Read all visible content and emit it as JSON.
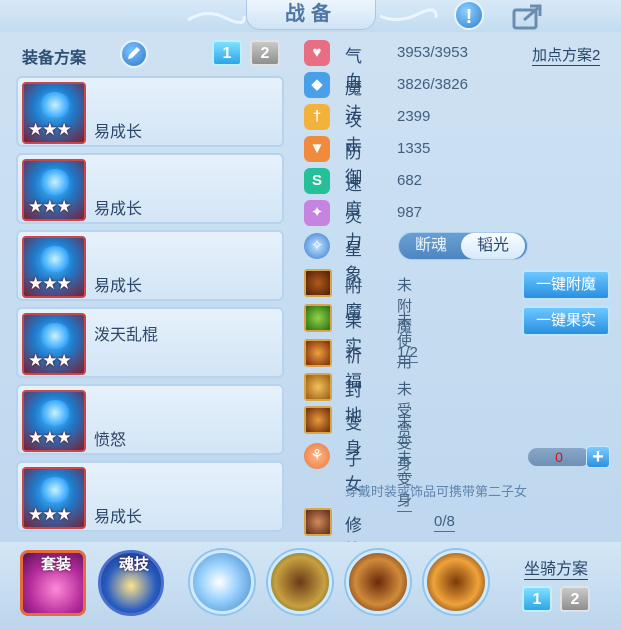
{
  "header": {
    "title": "战备",
    "warn_icon": "exclamation-icon",
    "share_icon": "share-icon"
  },
  "equip_plan": {
    "label": "装备方案",
    "plans": [
      "1",
      "2"
    ],
    "active_plan": "1",
    "items": [
      {
        "name": "易成长",
        "stars": "★★★"
      },
      {
        "name": "易成长",
        "stars": "★★★"
      },
      {
        "name": "易成长",
        "stars": "★★★"
      },
      {
        "name": "泼天乱棍",
        "stars": "★★★"
      },
      {
        "name": "愤怒",
        "stars": "★★★"
      },
      {
        "name": "易成长",
        "stars": "★★★"
      }
    ]
  },
  "attr_plan_link": "加点方案2",
  "stats": [
    {
      "name": "气血",
      "value": "3953/3953",
      "icon": "heart-icon",
      "color": "#e86e84"
    },
    {
      "name": "魔法",
      "value": "3826/3826",
      "icon": "magic-icon",
      "color": "#4aa0e8"
    },
    {
      "name": "攻击",
      "value": "2399",
      "icon": "sword-icon",
      "color": "#f2b33c"
    },
    {
      "name": "防御",
      "value": "1335",
      "icon": "shield-icon",
      "color": "#f08a3c"
    },
    {
      "name": "速度",
      "value": "682",
      "icon": "speed-icon",
      "color": "#25c09a"
    },
    {
      "name": "灵力",
      "value": "987",
      "icon": "spirit-icon",
      "color": "#c584e0"
    }
  ],
  "star_image": {
    "label": "星象",
    "options": [
      "断魂",
      "韬光"
    ],
    "selected": "韬光"
  },
  "extras": [
    {
      "name": "附魔",
      "value": "未附魔",
      "icon": "enchant-icon",
      "underline": false
    },
    {
      "name": "果实",
      "value": "未使用",
      "icon": "fruit-icon",
      "underline": false
    },
    {
      "name": "祈福",
      "value": "1/2",
      "icon": "pray-icon",
      "underline": true
    },
    {
      "name": "封地",
      "value": "未受赏",
      "icon": "fief-icon",
      "underline": true
    },
    {
      "name": "变身",
      "value": "未变身",
      "icon": "transform-icon",
      "underline": true
    }
  ],
  "buttons": {
    "enchant": "一键附魔",
    "fruit": "一键果实"
  },
  "children": {
    "name": "子女",
    "value": "未变身",
    "count": "0",
    "plus": "+"
  },
  "hint": "穿戴时装或饰品可携带第二子女",
  "awaken": {
    "name": "修炼觉醒",
    "value": "0/8"
  },
  "bottom": {
    "set_label": "套装",
    "soul_label": "魂技",
    "mount_label": "坐骑方案",
    "mount_plans": [
      "1",
      "2"
    ]
  }
}
